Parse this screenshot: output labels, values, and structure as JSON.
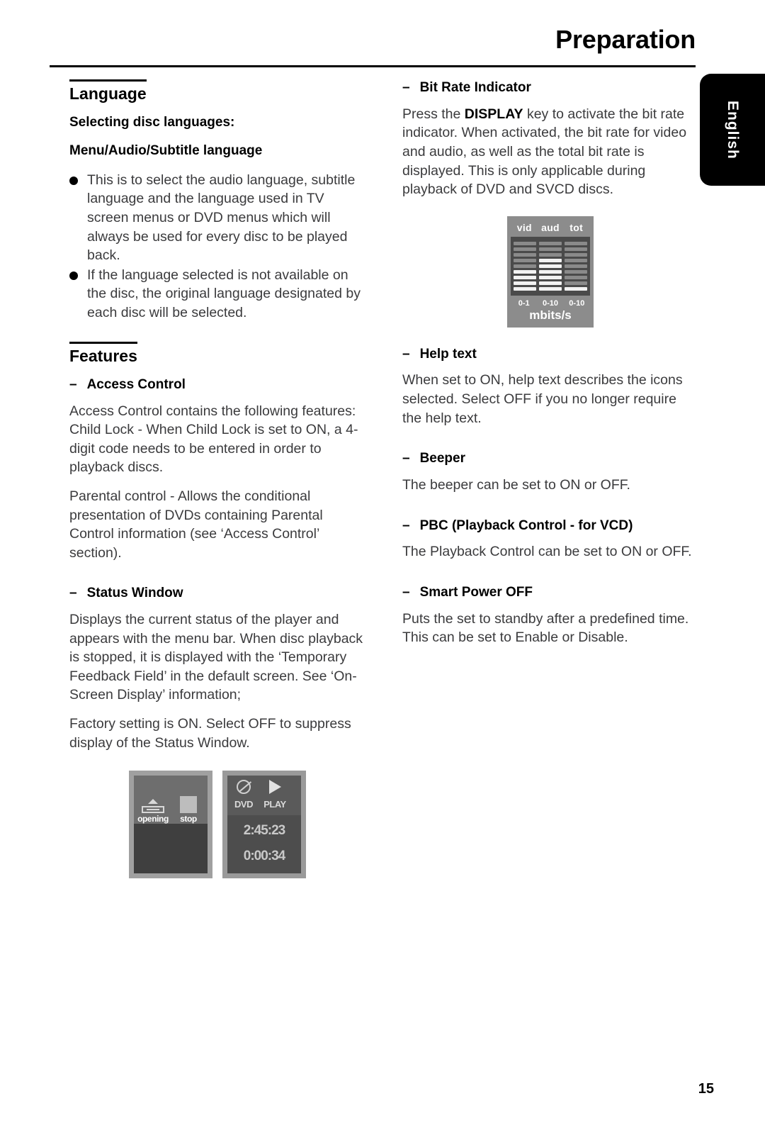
{
  "header": {
    "title": "Preparation"
  },
  "side_tab": {
    "label": "English"
  },
  "page_number": "15",
  "left_column": {
    "language_section": {
      "title": "Language",
      "subheading_1": "Selecting disc languages:",
      "subheading_2": "Menu/Audio/Subtitle language",
      "bullets": [
        "This is to select the audio language, subtitle language and the language used in TV screen menus or DVD menus which will always be used for every disc to be played back.",
        "If the language selected is not available on the disc, the original language designated by each disc will be selected."
      ]
    },
    "features_section": {
      "title": "Features",
      "access_control": {
        "dash": "–",
        "heading": "Access Control",
        "paragraph_1": "Access Control contains the following features: Child Lock - When Child Lock is set to ON, a 4-digit code needs to be entered in order to playback discs.",
        "paragraph_2": "Parental control - Allows the conditional presentation of DVDs containing Parental Control information (see ‘Access Control’ section)."
      },
      "status_window": {
        "dash": "–",
        "heading": "Status Window",
        "paragraph_1": "Displays the current status of the player and appears with the menu bar. When disc playback is stopped, it is displayed with the ‘Temporary Feedback Field’ in the default screen. See ‘On-Screen Display’ information;",
        "paragraph_2": "Factory setting is ON. Select OFF to suppress display of the Status Window."
      }
    }
  },
  "right_column": {
    "bit_rate": {
      "dash": "–",
      "heading": "Bit Rate Indicator",
      "paragraph_pre": "Press the ",
      "paragraph_key": "DISPLAY",
      "paragraph_post": " key to activate the bit rate indicator. When activated, the bit rate for video and audio, as well as the total bit rate is displayed. This is only applicable during playback of DVD and SVCD discs."
    },
    "help_text": {
      "dash": "–",
      "heading": "Help text",
      "paragraph": "When set to ON, help text describes the icons selected. Select OFF if you no longer require the help text."
    },
    "beeper": {
      "dash": "–",
      "heading": "Beeper",
      "paragraph": "The beeper can be set to ON or OFF."
    },
    "pbc": {
      "dash": "–",
      "heading": "PBC (Playback Control - for VCD)",
      "paragraph": "The Playback Control can be set to ON or OFF."
    },
    "smart_power_off": {
      "dash": "–",
      "heading": "Smart Power OFF",
      "paragraph": "Puts the set to standby after a predefined time. This can be set to Enable or Disable."
    }
  },
  "figures": {
    "bit_rate_indicator": {
      "columns": [
        "vid",
        "aud",
        "tot"
      ],
      "scales": [
        "0-1",
        "0-10",
        "0-10"
      ],
      "unit": "mbits/s",
      "segments_total": 9,
      "segments_lit": [
        4,
        6,
        1
      ]
    },
    "status_window_stopped": {
      "icon_1_label": "opening",
      "icon_1_name": "eject-icon",
      "icon_2_label": "stop",
      "icon_2_name": "stop-square-icon"
    },
    "status_window_playing": {
      "icon_no_entry": "no-entry-icon",
      "icon_play": "play-icon",
      "label_dvd": "DVD",
      "label_chapter": "PLAY",
      "time_total": "2:45:23",
      "time_elapsed": "0:00:34"
    }
  },
  "colors": {
    "text": "#3b3b3d",
    "heading": "#000000",
    "tab_bg": "#000000",
    "tab_text": "#ffffff",
    "figure_frame": "#8c8c8c",
    "figure_dark": "#4a4a4a"
  }
}
